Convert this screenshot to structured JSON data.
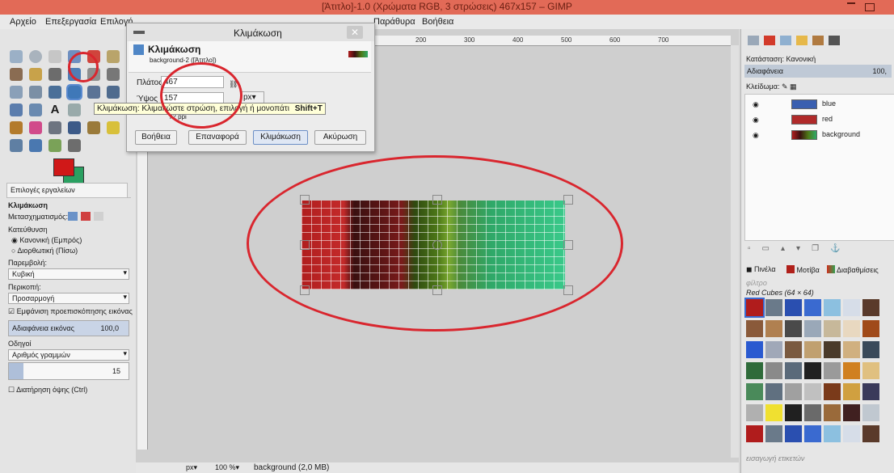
{
  "window": {
    "title": "[Άτιτλο]-1.0 (Χρώματα RGB, 3 στρώσεις) 467x157 – GIMP"
  },
  "menubar": [
    "Αρχείο",
    "Επεξεργασία",
    "Επιλογή",
    "Παράθυρα",
    "Βοήθεια"
  ],
  "dialog": {
    "title": "Κλιμάκωση",
    "heading": "Κλιμάκωση",
    "subheading": "background-2 ([Άτιτλο])",
    "width_label": "Πλάτος",
    "width_value": "467",
    "height_label": "Ύψος",
    "height_value": "157",
    "unit": "px",
    "resolution": "72 ppi",
    "buttons": {
      "help": "Βοήθεια",
      "reset": "Επαναφορά",
      "scale": "Κλιμάκωση",
      "cancel": "Ακύρωση"
    }
  },
  "tooltip": {
    "text": "Κλιμάκωση: Κλιμακώστε στρώση, επιλογή ή μονοπάτι",
    "shortcut": "Shift+T"
  },
  "tool_options": {
    "tab": "Επιλογές εργαλείων",
    "title": "Κλιμάκωση",
    "transform_label": "Μετασχηματισμός:",
    "direction_label": "Κατεύθυνση",
    "direction_normal": "Κανονική (Εμπρός)",
    "direction_corrective": "Διορθωτική (Πίσω)",
    "interpolation_label": "Παρεμβολή:",
    "interpolation_value": "Κυβική",
    "clipping_label": "Περικοπή:",
    "clipping_value": "Προσαρμογή",
    "preview_label": "Εμφάνιση προεπισκόπησης εικόνας",
    "opacity_label": "Αδιαφάνεια εικόνας",
    "opacity_value": "100,0",
    "guides_label": "Οδηγοί",
    "guides_value": "Αριθμός γραμμών",
    "lines_value": "15",
    "keep_aspect_label": "Διατήρηση όψης (Ctrl)"
  },
  "ruler": [
    "200",
    "300",
    "400",
    "500",
    "600",
    "700"
  ],
  "layers": {
    "mode_label": "Κατάσταση: Κανονική",
    "opacity_label": "Αδιαφάνεια",
    "opacity_value": "100,",
    "lock_label": "Κλείδωμα:",
    "items": [
      {
        "name": "blue",
        "color": "#3a5fb0"
      },
      {
        "name": "red",
        "color": "#b02a2a"
      },
      {
        "name": "background",
        "color": "#5b8a3a"
      }
    ]
  },
  "patterns": {
    "tabs": [
      "Πινέλα",
      "Μοτίβα",
      "Διαβαθμίσεις"
    ],
    "filter_placeholder": "φίλτρο",
    "current": "Red Cubes (64 × 64)",
    "tag_placeholder": "εισαγωγή ετικετών"
  },
  "statusbar": {
    "unit": "px",
    "zoom": "100 %",
    "info": "background (2,0 MB)"
  },
  "colors": {
    "fg": "#d01818",
    "bg": "#2aa061",
    "annotation": "#d9262e"
  }
}
